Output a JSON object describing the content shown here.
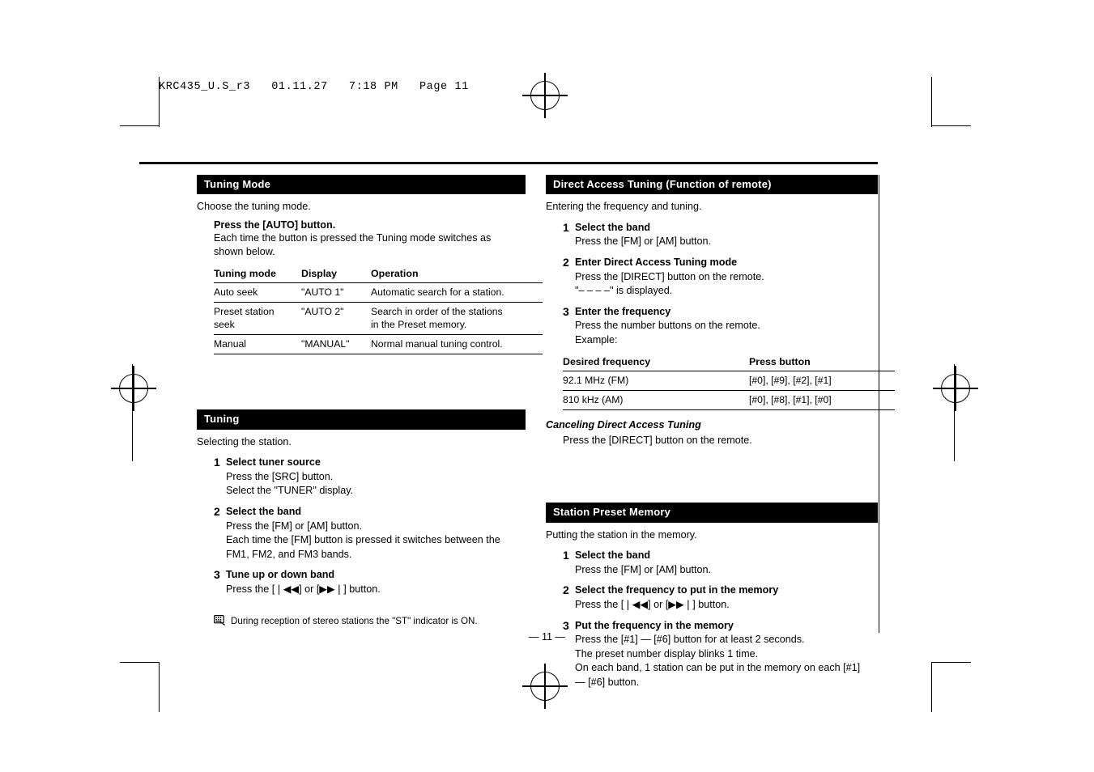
{
  "film_header": "KRC435_U.S_r3   01.11.27   7:18 PM   Page 11",
  "folio": "— 11 —",
  "left_column": {
    "tuning_mode": {
      "title": "Tuning Mode",
      "intro": "Choose the tuning mode.",
      "instruction_bold": "Press the [AUTO] button.",
      "instruction_line1": "Each time the button is pressed the Tuning mode switches as",
      "instruction_line2": "shown below.",
      "table": {
        "headers": [
          "Tuning mode",
          "Display",
          "Operation"
        ],
        "rows": [
          {
            "mode": "Auto seek",
            "display": "\"AUTO 1\"",
            "operation_line1": "Automatic search for a station.",
            "operation_line2": ""
          },
          {
            "mode": "Preset station",
            "mode_line2": "seek",
            "display": "\"AUTO 2\"",
            "operation_line1": "Search in order of the stations",
            "operation_line2": "in the Preset memory."
          },
          {
            "mode": "Manual",
            "display": "\"MANUAL\"",
            "operation_line1": "Normal manual tuning control.",
            "operation_line2": ""
          }
        ]
      }
    },
    "tuning": {
      "title": "Tuning",
      "intro": "Selecting the station.",
      "steps": [
        {
          "num": "1",
          "title": "Select tuner source",
          "lines": [
            "Press the [SRC] button.",
            "Select the \"TUNER\" display."
          ]
        },
        {
          "num": "2",
          "title": "Select the band",
          "lines": [
            "Press the [FM] or [AM] button.",
            "Each time the [FM] button is pressed it switches between the",
            "FM1, FM2, and FM3 bands."
          ]
        },
        {
          "num": "3",
          "title": "Tune up or down band",
          "lines": [
            "Press the [❘◀◀] or [▶▶❘] button."
          ]
        }
      ],
      "note": "During reception of stereo stations the \"ST\" indicator is ON.",
      "note_icon": "note-keypad-icon"
    }
  },
  "right_column": {
    "direct_access": {
      "title": "Direct Access Tuning (Function of remote)",
      "intro": "Entering the frequency and tuning.",
      "steps": [
        {
          "num": "1",
          "title": "Select the band",
          "lines": [
            "Press the [FM] or [AM] button."
          ]
        },
        {
          "num": "2",
          "title": "Enter Direct Access Tuning mode",
          "lines": [
            "Press the [DIRECT] button on the remote.",
            "\"– – – –\" is displayed."
          ]
        },
        {
          "num": "3",
          "title": "Enter the frequency",
          "lines": [
            "Press the number buttons on the remote.",
            "Example:"
          ]
        }
      ],
      "table": {
        "headers": [
          "Desired frequency",
          "Press button"
        ],
        "rows": [
          {
            "freq": "92.1 MHz (FM)",
            "buttons": "[#0], [#9], [#2], [#1]"
          },
          {
            "freq": "810 kHz (AM)",
            "buttons": "[#0], [#8], [#1], [#0]"
          }
        ]
      },
      "cancel_heading": "Canceling Direct Access Tuning",
      "cancel_line": "Press the [DIRECT] button on the remote."
    },
    "station_preset": {
      "title": "Station Preset Memory",
      "intro": "Putting the station in the memory.",
      "steps": [
        {
          "num": "1",
          "title": "Select the band",
          "lines": [
            "Press the [FM] or [AM] button."
          ]
        },
        {
          "num": "2",
          "title": "Select the frequency to put in the memory",
          "lines": [
            "Press the [❘◀◀] or [▶▶❘] button."
          ]
        },
        {
          "num": "3",
          "title": "Put the frequency in the memory",
          "lines": [
            "Press the [#1] — [#6] button for at least 2 seconds.",
            "The preset number display blinks 1 time.",
            "On each band, 1 station can be put in the memory on each [#1]",
            "— [#6] button."
          ]
        }
      ]
    }
  }
}
